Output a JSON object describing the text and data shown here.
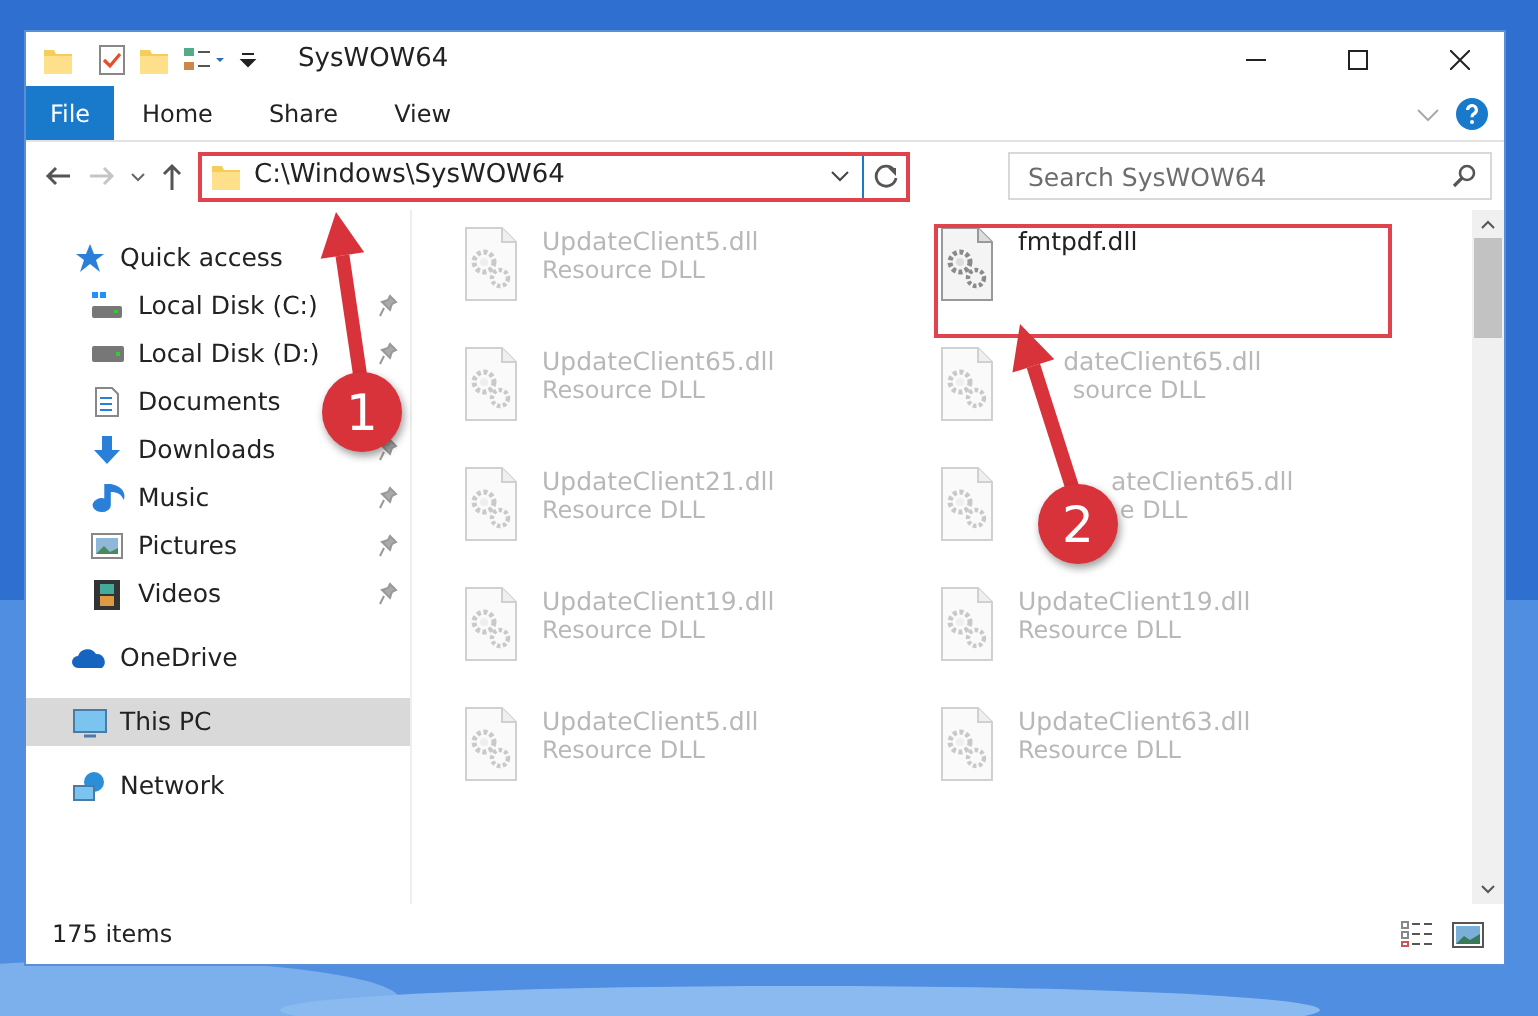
{
  "window": {
    "title": "SysWOW64"
  },
  "ribbon_tabs": [
    {
      "label": "File",
      "kind": "file",
      "selected": false
    },
    {
      "label": "Home",
      "kind": "tab",
      "selected": false
    },
    {
      "label": "Share",
      "kind": "tab",
      "selected": false
    },
    {
      "label": "View",
      "kind": "tab",
      "selected": false
    }
  ],
  "address_bar": {
    "path": "C:\\Windows\\SysWOW64"
  },
  "search": {
    "placeholder": "Search SysWOW64"
  },
  "sidebar": {
    "items": [
      {
        "label": "Quick access",
        "kind": "star",
        "selected": false,
        "children": [
          {
            "label": "Local Disk (C:)",
            "kind": "sysdrive",
            "pinned": true,
            "selected": false
          },
          {
            "label": "Local Disk (D:)",
            "kind": "drive",
            "pinned": true,
            "selected": false
          },
          {
            "label": "Documents",
            "kind": "documents",
            "selected": false
          },
          {
            "label": "Downloads",
            "kind": "downloads",
            "pinned": true,
            "selected": false
          },
          {
            "label": "Music",
            "kind": "music",
            "pinned": true,
            "selected": false
          },
          {
            "label": "Pictures",
            "kind": "pictures",
            "pinned": true,
            "selected": false
          },
          {
            "label": "Videos",
            "kind": "videos",
            "pinned": true,
            "selected": false
          }
        ]
      },
      {
        "label": "OneDrive",
        "kind": "cloud",
        "selected": false
      },
      {
        "label": "This PC",
        "kind": "pc",
        "selected": true
      },
      {
        "label": "Network",
        "kind": "network",
        "selected": false
      }
    ]
  },
  "files": [
    {
      "name": "UpdateClient5.dll",
      "type": "Resource DLL",
      "blurred": true
    },
    {
      "name": "fmtpdf.dll",
      "blurred": false
    },
    {
      "name": "UpdateClient65.dll",
      "type": "Resource DLL",
      "blurred": true
    },
    {
      "name": "dateClient65.dll",
      "type": "source DLL",
      "blurred": true
    },
    {
      "name": "UpdateClient21.dll",
      "type": "Resource DLL",
      "blurred": true
    },
    {
      "name": "ateClient65.dll",
      "type": "e DLL",
      "blurred": true
    },
    {
      "name": "UpdateClient19.dll",
      "type": "Resource DLL",
      "blurred": true
    },
    {
      "name": "UpdateClient19.dll",
      "type": "Resource DLL",
      "blurred": true
    },
    {
      "name": "UpdateClient5.dll",
      "type": "Resource DLL",
      "blurred": true
    },
    {
      "name": "UpdateClient63.dll",
      "type": "Resource DLL",
      "blurred": true
    }
  ],
  "status_bar": {
    "item_count": "175 items"
  },
  "annotations": [
    {
      "label": "1"
    },
    {
      "label": "2"
    }
  ]
}
